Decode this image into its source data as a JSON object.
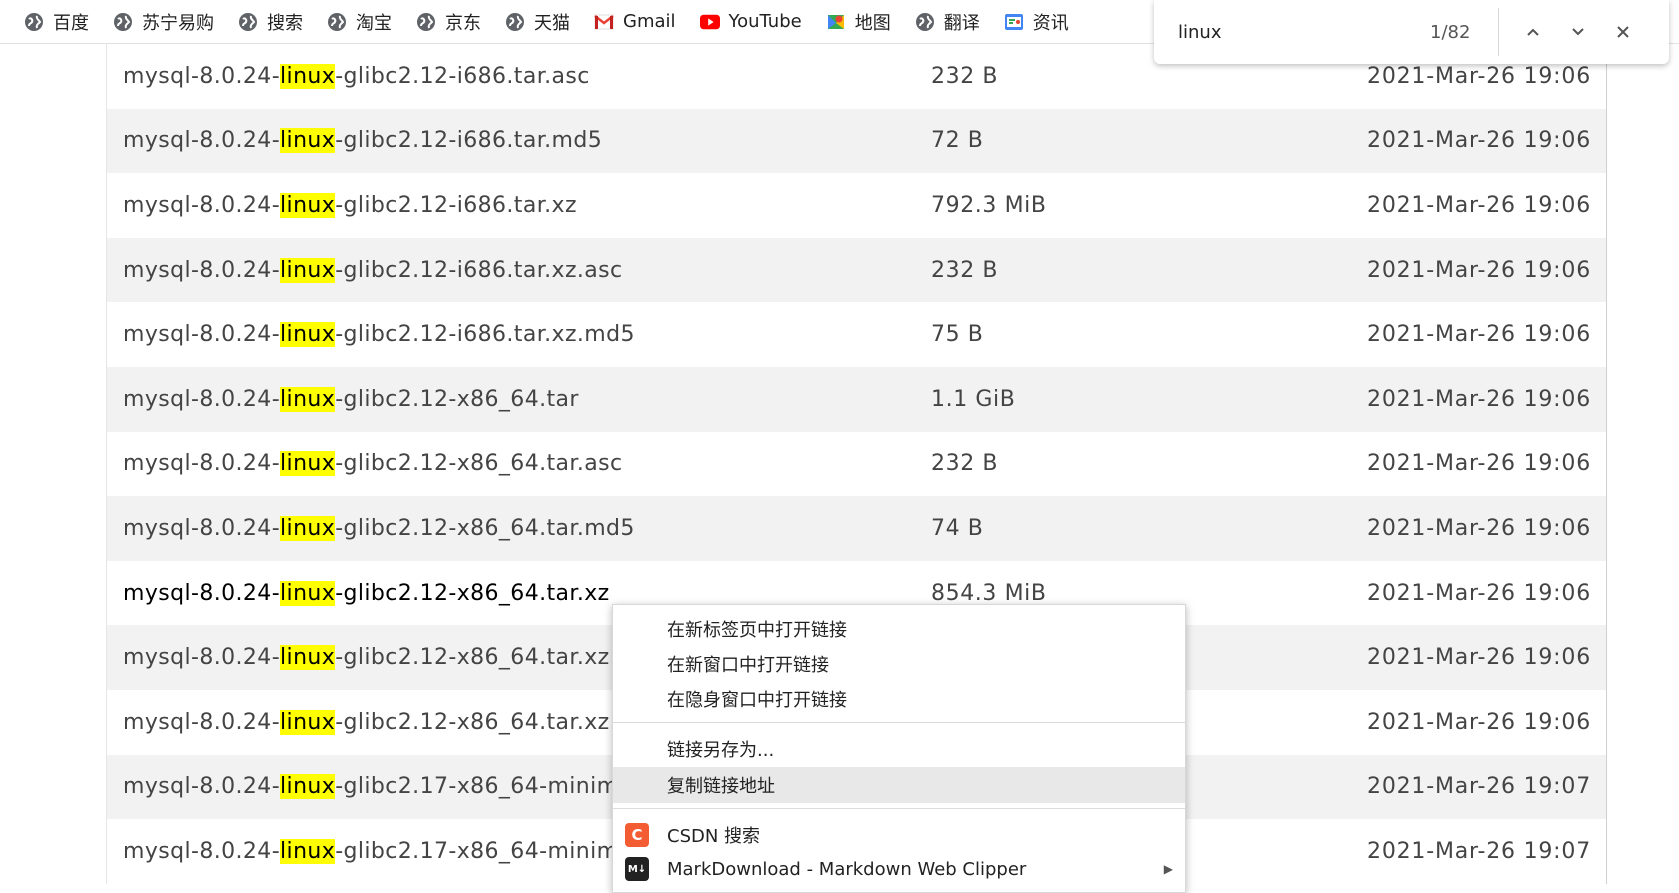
{
  "bookmarks": [
    {
      "label": "百度",
      "icon": "globe-icon"
    },
    {
      "label": "苏宁易购",
      "icon": "globe-icon"
    },
    {
      "label": "搜索",
      "icon": "globe-icon"
    },
    {
      "label": "淘宝",
      "icon": "globe-icon"
    },
    {
      "label": "京东",
      "icon": "globe-icon"
    },
    {
      "label": "天猫",
      "icon": "globe-icon"
    },
    {
      "label": "Gmail",
      "icon": "gmail-icon"
    },
    {
      "label": "YouTube",
      "icon": "youtube-icon"
    },
    {
      "label": "地图",
      "icon": "maps-icon"
    },
    {
      "label": "翻译",
      "icon": "globe-icon"
    },
    {
      "label": "资讯",
      "icon": "news-icon"
    }
  ],
  "find": {
    "query": "linux",
    "count": "1/82"
  },
  "files": [
    {
      "pre": "mysql-8.0.24-",
      "hl": "linux",
      "post": "-glibc2.12-i686.tar.asc",
      "size": "232 B",
      "date": "2021-Mar-26 19:06"
    },
    {
      "pre": "mysql-8.0.24-",
      "hl": "linux",
      "post": "-glibc2.12-i686.tar.md5",
      "size": "72 B",
      "date": "2021-Mar-26 19:06"
    },
    {
      "pre": "mysql-8.0.24-",
      "hl": "linux",
      "post": "-glibc2.12-i686.tar.xz",
      "size": "792.3 MiB",
      "date": "2021-Mar-26 19:06"
    },
    {
      "pre": "mysql-8.0.24-",
      "hl": "linux",
      "post": "-glibc2.12-i686.tar.xz.asc",
      "size": "232 B",
      "date": "2021-Mar-26 19:06"
    },
    {
      "pre": "mysql-8.0.24-",
      "hl": "linux",
      "post": "-glibc2.12-i686.tar.xz.md5",
      "size": "75 B",
      "date": "2021-Mar-26 19:06"
    },
    {
      "pre": "mysql-8.0.24-",
      "hl": "linux",
      "post": "-glibc2.12-x86_64.tar",
      "size": "1.1 GiB",
      "date": "2021-Mar-26 19:06"
    },
    {
      "pre": "mysql-8.0.24-",
      "hl": "linux",
      "post": "-glibc2.12-x86_64.tar.asc",
      "size": "232 B",
      "date": "2021-Mar-26 19:06"
    },
    {
      "pre": "mysql-8.0.24-",
      "hl": "linux",
      "post": "-glibc2.12-x86_64.tar.md5",
      "size": "74 B",
      "date": "2021-Mar-26 19:06"
    },
    {
      "pre": "mysql-8.0.24-",
      "hl": "linux",
      "post": "-glibc2.12-x86_64.tar.xz",
      "size": "854.3 MiB",
      "date": "2021-Mar-26 19:06"
    },
    {
      "pre": "mysql-8.0.24-",
      "hl": "linux",
      "post": "-glibc2.12-x86_64.tar.xz.",
      "size": "",
      "date": "2021-Mar-26 19:06"
    },
    {
      "pre": "mysql-8.0.24-",
      "hl": "linux",
      "post": "-glibc2.12-x86_64.tar.xz.",
      "size": "",
      "date": "2021-Mar-26 19:06"
    },
    {
      "pre": "mysql-8.0.24-",
      "hl": "linux",
      "post": "-glibc2.17-x86_64-minim",
      "size": "",
      "date": "2021-Mar-26 19:07"
    },
    {
      "pre": "mysql-8.0.24-",
      "hl": "linux",
      "post": "-glibc2.17-x86_64-minim",
      "size": "",
      "date": "2021-Mar-26 19:07"
    }
  ],
  "context_menu": {
    "items": [
      {
        "label": "在新标签页中打开链接"
      },
      {
        "label": "在新窗口中打开链接"
      },
      {
        "label": "在隐身窗口中打开链接"
      },
      {
        "label": "链接另存为..."
      },
      {
        "label": "复制链接地址"
      },
      {
        "label": "CSDN 搜索",
        "icon": "csdn-icon",
        "icon_text": "C",
        "icon_color": "#f45c34"
      },
      {
        "label": "MarkDownload - Markdown Web Clipper",
        "icon": "markdown-icon",
        "icon_text": "M↓",
        "icon_color": "#222222"
      }
    ]
  },
  "colors": {
    "highlight": "#ffff00",
    "row_alt": "#f2f2f2",
    "menu_active": "#e8e8e8"
  }
}
